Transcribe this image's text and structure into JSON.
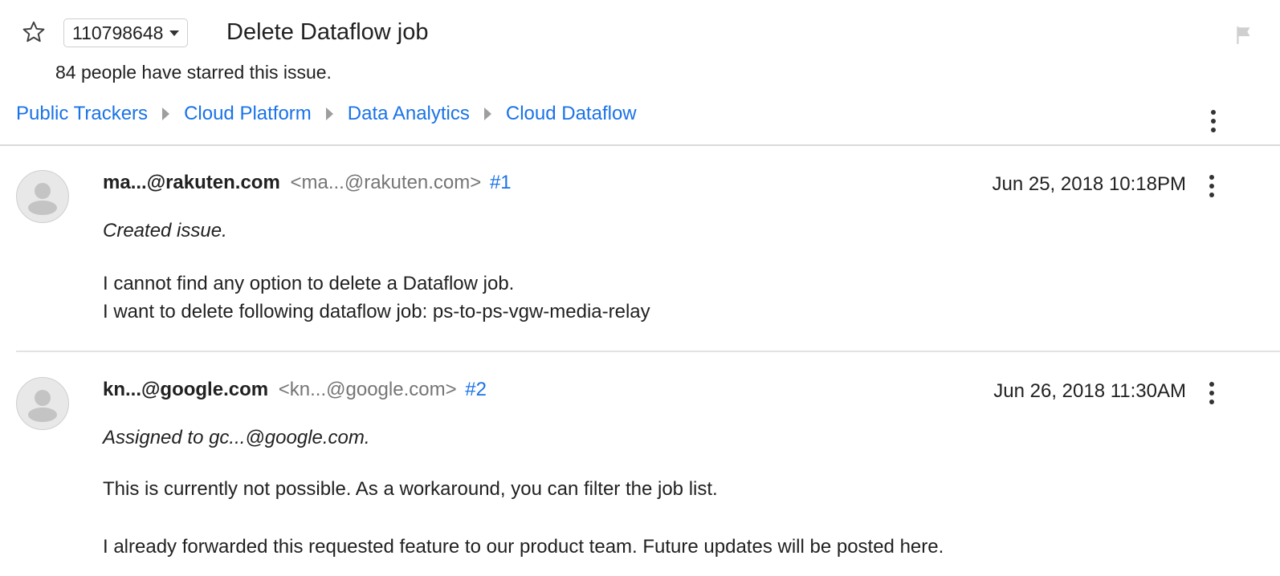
{
  "issue": {
    "id": "110798648",
    "title": "Delete Dataflow job",
    "starred_text": "84 people have starred this issue."
  },
  "breadcrumb": [
    {
      "label": "Public Trackers"
    },
    {
      "label": "Cloud Platform"
    },
    {
      "label": "Data Analytics"
    },
    {
      "label": "Cloud Dataflow"
    }
  ],
  "comments": [
    {
      "author": "ma...@rakuten.com",
      "email": "<ma...@rakuten.com>",
      "number": "#1",
      "date": "Jun 25, 2018 10:18PM",
      "action": "Created issue.",
      "lines": [
        "I cannot find any option to delete a Dataflow job.",
        "I want to delete following dataflow job:  ps-to-ps-vgw-media-relay"
      ]
    },
    {
      "author": "kn...@google.com",
      "email": "<kn...@google.com>",
      "number": "#2",
      "date": "Jun 26, 2018 11:30AM",
      "action": "Assigned to gc...@google.com.",
      "lines": [
        "This is currently not possible. As a workaround, you can filter the job list.",
        "I already forwarded this requested feature to our product team. Future updates will be posted here."
      ]
    }
  ],
  "icons": {
    "star": "star-outline-icon",
    "flag": "flag-icon",
    "menu": "more-vert-icon",
    "avatar": "default-avatar-icon"
  },
  "colors": {
    "link": "#1a73e8",
    "muted": "#757575",
    "text": "#212121",
    "divider": "#dadada"
  }
}
